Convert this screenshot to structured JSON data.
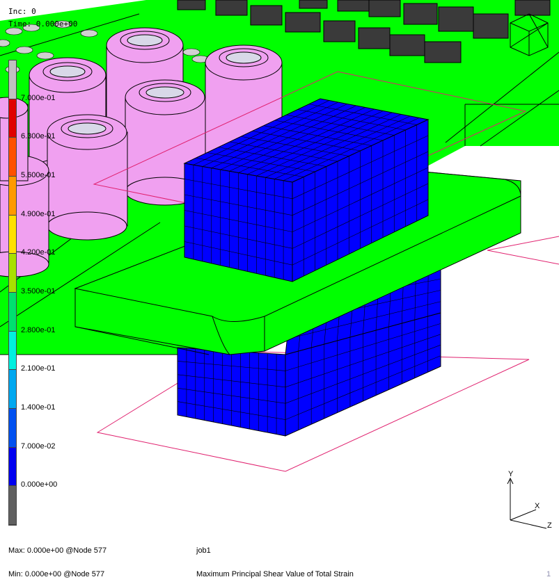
{
  "hud": {
    "inc": "Inc:   0",
    "time": "Time: 0.000e+00"
  },
  "legend": {
    "labels": [
      "7.000e-01",
      "6.300e-01",
      "5.600e-01",
      "4.900e-01",
      "4.200e-01",
      "3.500e-01",
      "2.800e-01",
      "2.100e-01",
      "1.400e-01",
      "7.000e-02",
      "0.000e+00"
    ],
    "colors": [
      "#c0c0c0",
      "#e00000",
      "#ff5000",
      "#ff9a00",
      "#ffe000",
      "#a8e000",
      "#00e070",
      "#00f0e0",
      "#00a8f0",
      "#0050f0",
      "#0000f0",
      "#606060"
    ]
  },
  "footer": {
    "max": "Max:  0.000e+00 @Node  577",
    "min": "Min:  0.000e+00 @Node  577",
    "job": "job1",
    "title": "Maximum Principal Shear Value of Total Strain",
    "frame": "1"
  },
  "axes": {
    "y": "Y",
    "x": "X",
    "z": "Z"
  },
  "colors": {
    "board": "#00ff00",
    "mesh": "#0000ff",
    "capacitor": "#f0a0f0",
    "chip": "#3a3a3a",
    "outline": "#e0206e"
  }
}
